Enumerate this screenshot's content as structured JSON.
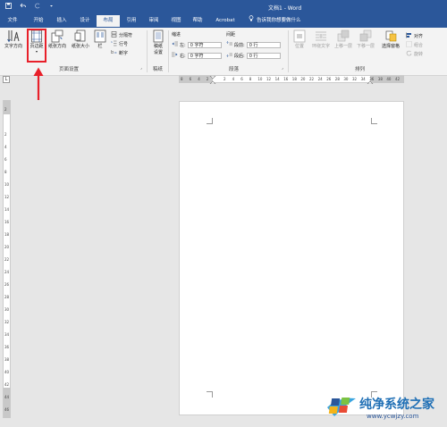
{
  "app": {
    "title": "文档1 - Word",
    "tabs": [
      "文件",
      "开始",
      "插入",
      "设计",
      "布局",
      "引用",
      "审阅",
      "视图",
      "帮助",
      "Acrobat"
    ],
    "active_tab": "布局",
    "tell_me": "告诉我你想要做什么"
  },
  "ribbon": {
    "page_setup": {
      "text_direction": "文字方向",
      "margins": "页边距",
      "orientation": "纸张方向",
      "size": "纸张大小",
      "columns": "栏",
      "breaks": "分隔符",
      "line_numbers": "行号",
      "hyphenation": "断字",
      "label": "页面设置"
    },
    "draft": {
      "button": "稿纸设置",
      "label": "稿纸"
    },
    "paragraph": {
      "indent": "缩进",
      "spacing": "间距",
      "left": "左:",
      "right": "右:",
      "before": "段前:",
      "after": "段后:",
      "left_value": "0 字符",
      "right_value": "0 字符",
      "before_value": "0 行",
      "after_value": "0 行",
      "label": "段落"
    },
    "arrange": {
      "position": "位置",
      "wrap_text": "环绕文字",
      "bring_forward": "上移一层",
      "send_backward": "下移一层",
      "selection_pane": "选择窗格",
      "align": "对齐",
      "group": "组合",
      "rotate": "旋转",
      "label": "排列"
    }
  },
  "ruler": {
    "corner": "L",
    "top_numbers": [
      "8",
      "6",
      "4",
      "2",
      "",
      "2",
      "4",
      "6",
      "8",
      "10",
      "12",
      "14",
      "16",
      "18",
      "20",
      "22",
      "24",
      "26",
      "28",
      "30",
      "32",
      "34",
      "36",
      "38",
      "40",
      "42"
    ],
    "left_numbers": [
      "2",
      "",
      "2",
      "4",
      "6",
      "8",
      "10",
      "12",
      "14",
      "16",
      "18",
      "20",
      "22",
      "24",
      "26",
      "28",
      "30",
      "32",
      "34",
      "36",
      "38",
      "40",
      "42",
      "44",
      "46"
    ]
  },
  "watermark": {
    "brand": "纯净系统之家",
    "url": "www.ycwjzy.com"
  },
  "colors": {
    "titlebar": "#2b579a",
    "ribbon": "#f3f3f3",
    "highlight": "#e8202a"
  }
}
